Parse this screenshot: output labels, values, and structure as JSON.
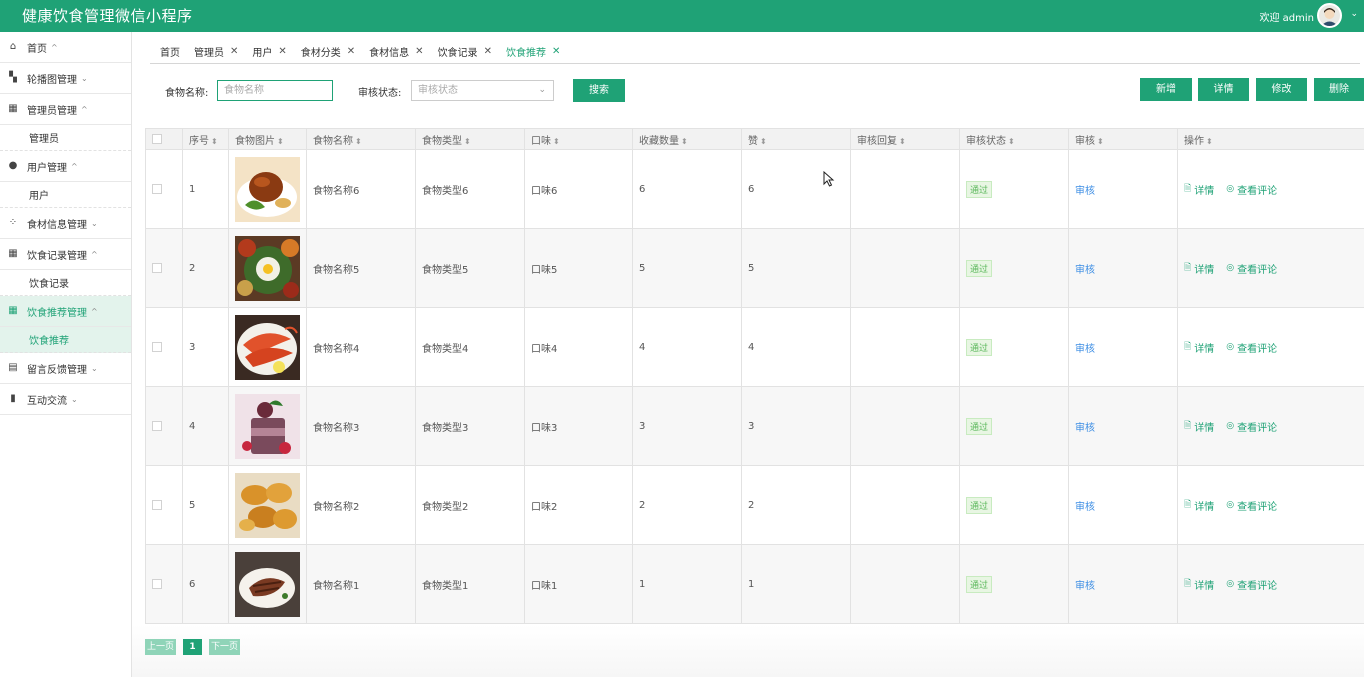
{
  "header": {
    "title": "健康饮食管理微信小程序",
    "welcome": "欢迎 admin",
    "brand_color": "#1fa276"
  },
  "sidebar": {
    "items": [
      {
        "label": "首页",
        "icon": "home-icon",
        "chevron": "^"
      },
      {
        "label": "轮播图管理",
        "icon": "carousel-icon",
        "chevron": "v"
      },
      {
        "label": "管理员管理",
        "icon": "grid-icon",
        "chevron": "^"
      },
      {
        "label": "管理员",
        "sub": true
      },
      {
        "label": "用户管理",
        "icon": "user-icon",
        "chevron": "^"
      },
      {
        "label": "用户",
        "sub": true
      },
      {
        "label": "食材信息管理",
        "icon": "ingredient-icon",
        "chevron": "v"
      },
      {
        "label": "饮食记录管理",
        "icon": "grid-icon",
        "chevron": "^"
      },
      {
        "label": "饮食记录",
        "sub": true
      },
      {
        "label": "饮食推荐管理",
        "icon": "grid-icon",
        "chevron": "^",
        "active": true
      },
      {
        "label": "饮食推荐",
        "sub": true,
        "active": true
      },
      {
        "label": "留言反馈管理",
        "icon": "table-icon",
        "chevron": "v"
      },
      {
        "label": "互动交流",
        "icon": "book-icon",
        "chevron": "v"
      }
    ]
  },
  "tabs": [
    {
      "label": "首页",
      "closable": false
    },
    {
      "label": "管理员",
      "closable": true
    },
    {
      "label": "用户",
      "closable": true
    },
    {
      "label": "食材分类",
      "closable": true
    },
    {
      "label": "食材信息",
      "closable": true
    },
    {
      "label": "饮食记录",
      "closable": true
    },
    {
      "label": "饮食推荐",
      "closable": true,
      "active": true
    }
  ],
  "search": {
    "name_label": "食物名称:",
    "name_placeholder": "食物名称",
    "status_label": "审核状态:",
    "status_placeholder": "审核状态",
    "search_button": "搜索"
  },
  "actions": {
    "add": "新增",
    "detail": "详情",
    "edit": "修改",
    "delete": "删除"
  },
  "table": {
    "columns": [
      "序号",
      "食物图片",
      "食物名称",
      "食物类型",
      "口味",
      "收藏数量",
      "赞",
      "审核回复",
      "审核状态",
      "审核",
      "操作"
    ],
    "rows": [
      {
        "no": "1",
        "name": "食物名称6",
        "type": "食物类型6",
        "taste": "口味6",
        "fav": "6",
        "like": "6",
        "reply": "",
        "status": "通过",
        "audit": "审核",
        "op_detail": "详情",
        "op_comment": "查看评论",
        "image": "roast-meat-icon"
      },
      {
        "no": "2",
        "name": "食物名称5",
        "type": "食物类型5",
        "taste": "口味5",
        "fav": "5",
        "like": "5",
        "reply": "",
        "status": "通过",
        "audit": "审核",
        "op_detail": "详情",
        "op_comment": "查看评论",
        "image": "dish-platter-icon"
      },
      {
        "no": "3",
        "name": "食物名称4",
        "type": "食物类型4",
        "taste": "口味4",
        "fav": "4",
        "like": "4",
        "reply": "",
        "status": "通过",
        "audit": "审核",
        "op_detail": "详情",
        "op_comment": "查看评论",
        "image": "shrimp-icon"
      },
      {
        "no": "4",
        "name": "食物名称3",
        "type": "食物类型3",
        "taste": "口味3",
        "fav": "3",
        "like": "3",
        "reply": "",
        "status": "通过",
        "audit": "审核",
        "op_detail": "详情",
        "op_comment": "查看评论",
        "image": "dessert-icon"
      },
      {
        "no": "5",
        "name": "食物名称2",
        "type": "食物类型2",
        "taste": "口味2",
        "fav": "2",
        "like": "2",
        "reply": "",
        "status": "通过",
        "audit": "审核",
        "op_detail": "详情",
        "op_comment": "查看评论",
        "image": "fried-food-icon"
      },
      {
        "no": "6",
        "name": "食物名称1",
        "type": "食物类型1",
        "taste": "口味1",
        "fav": "1",
        "like": "1",
        "reply": "",
        "status": "通过",
        "audit": "审核",
        "op_detail": "详情",
        "op_comment": "查看评论",
        "image": "steak-plate-icon"
      }
    ]
  },
  "pagination": {
    "prev": "上一页",
    "current": "1",
    "next": "下一页"
  }
}
